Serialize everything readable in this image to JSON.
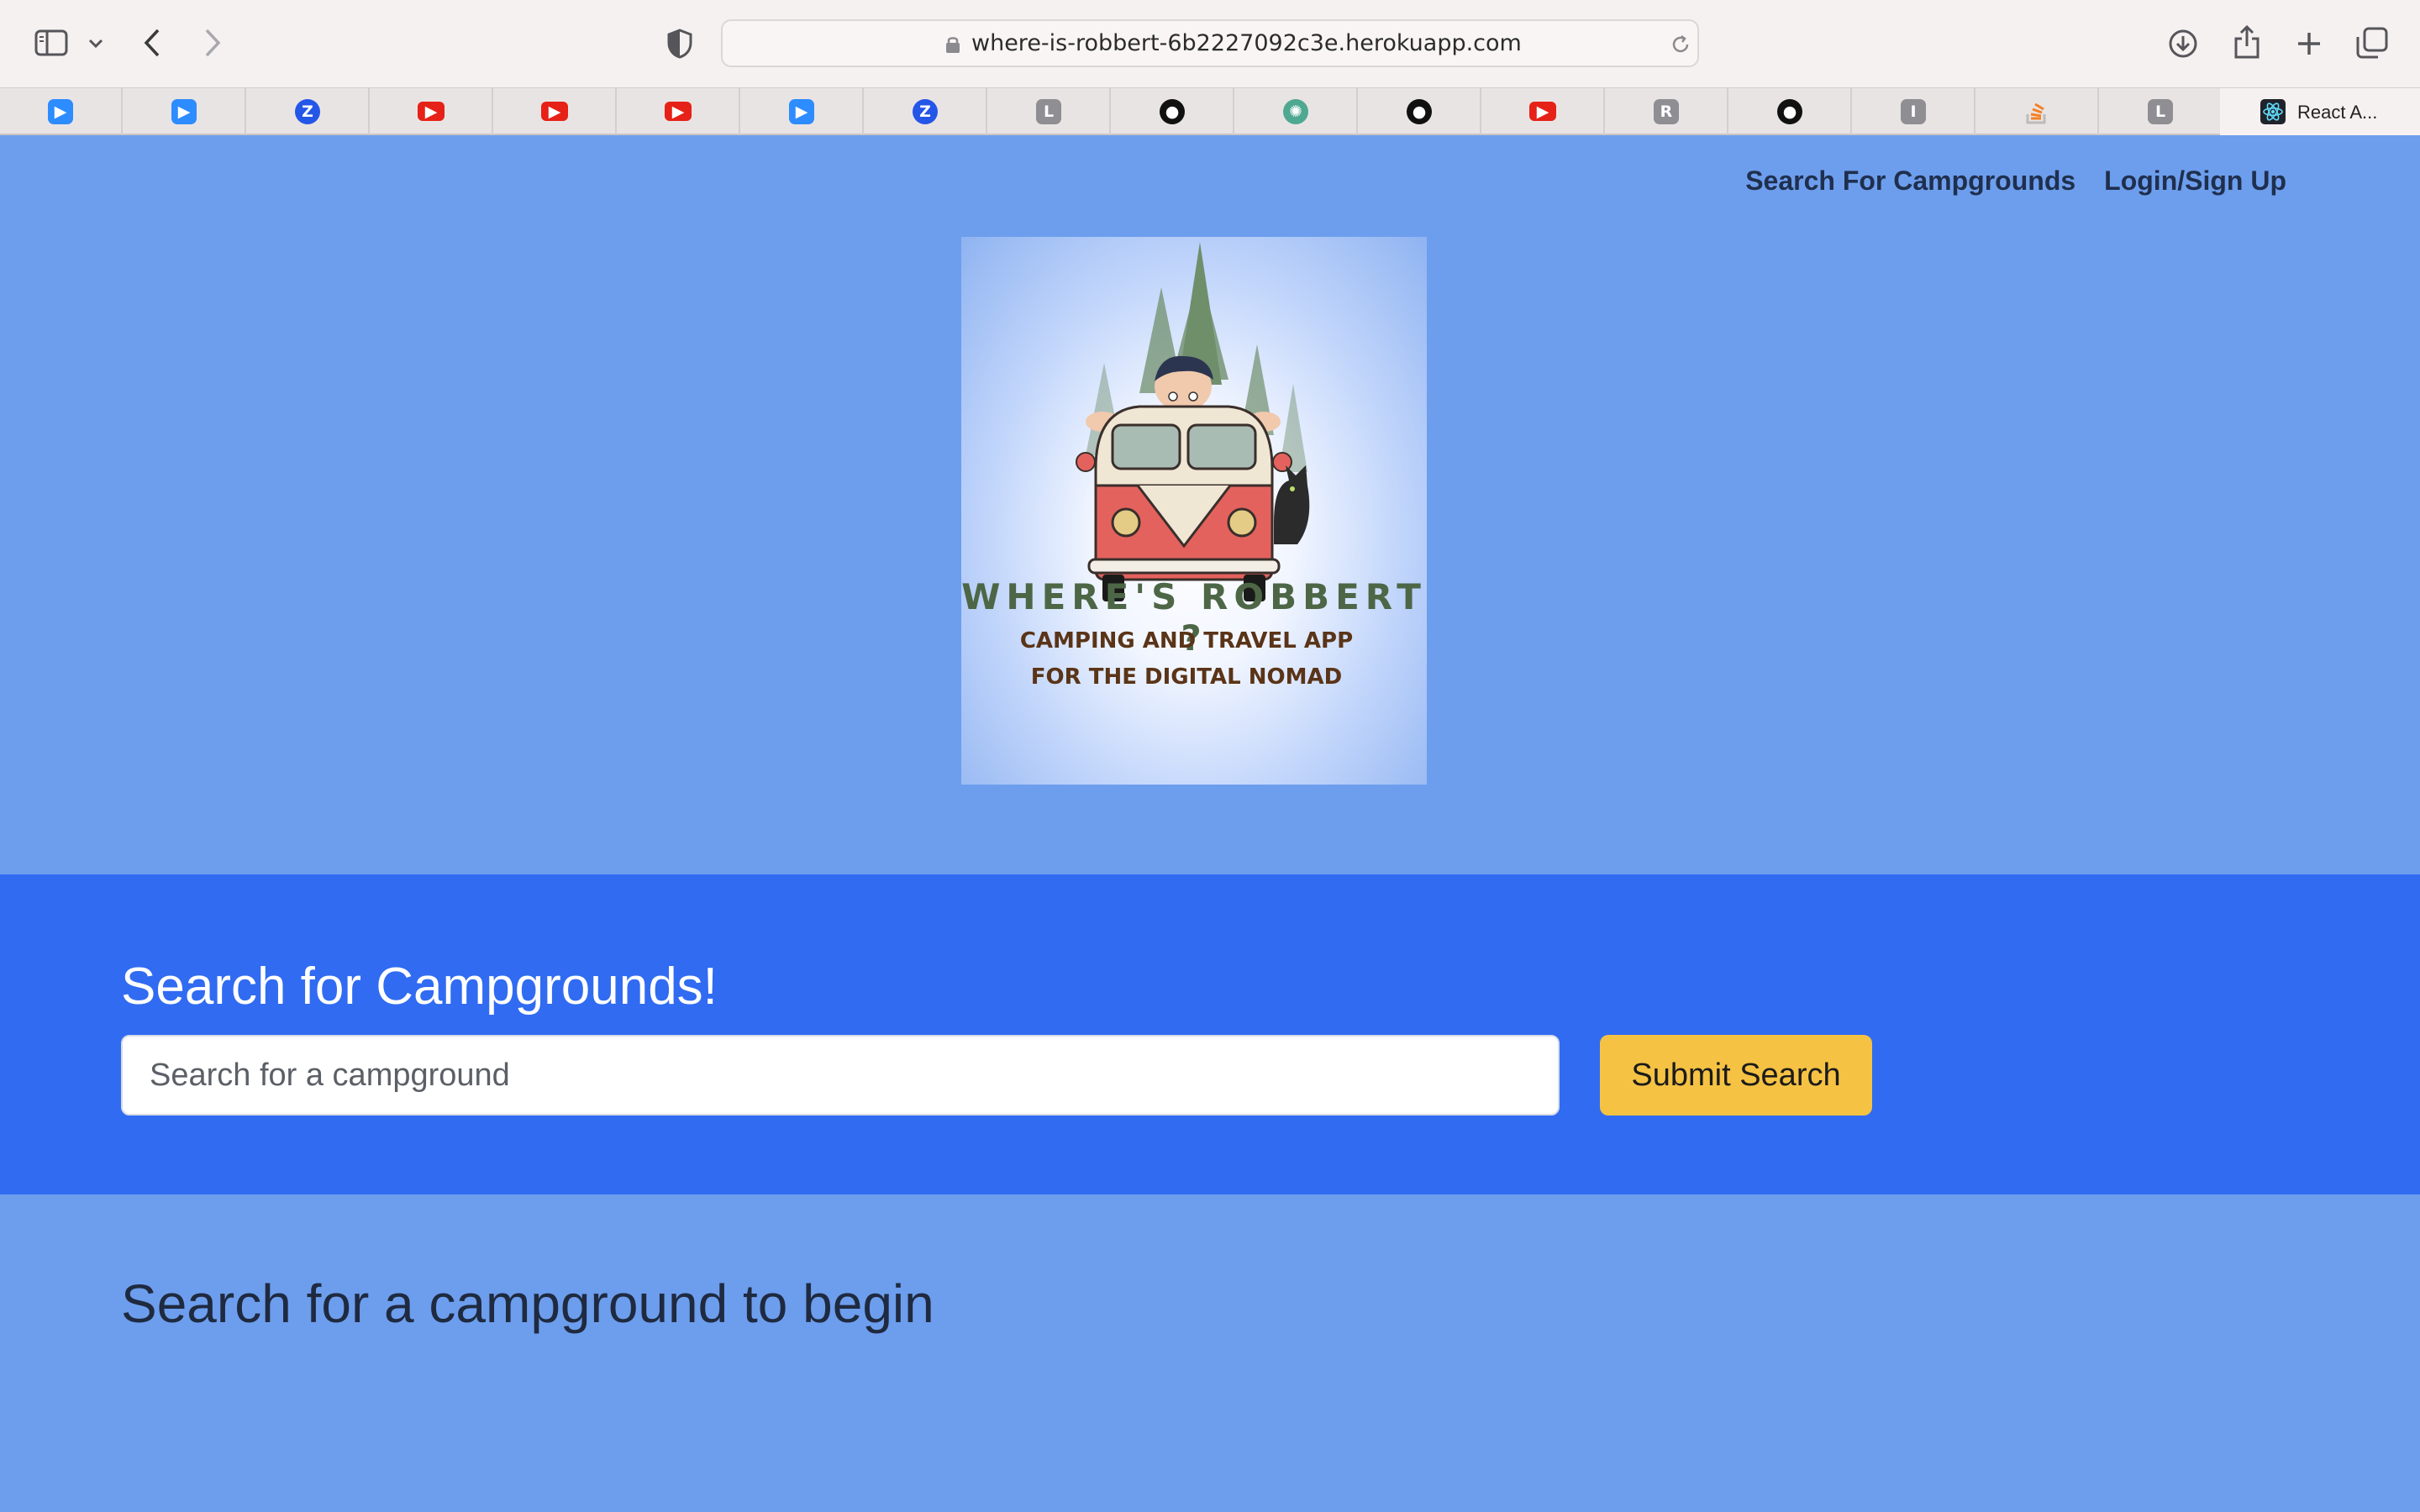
{
  "browser": {
    "url": "where-is-robbert-6b2227092c3e.herokuapp.com",
    "active_tab_title": "React A...",
    "tab_favicons": [
      "zoom-icon",
      "zoom-icon",
      "zotero-icon",
      "youtube-icon",
      "youtube-icon",
      "youtube-icon",
      "zoom-icon",
      "zotero-icon",
      "letter-l-icon",
      "github-icon",
      "chatgpt-icon",
      "github-icon",
      "youtube-icon",
      "letter-r-icon",
      "github-icon",
      "letter-i-icon",
      "stackoverflow-icon",
      "letter-l-icon"
    ],
    "tab_letters": {
      "letter-l-icon": "L",
      "letter-r-icon": "R",
      "letter-i-icon": "I",
      "zotero-icon": "Z"
    }
  },
  "nav": {
    "search_link": "Search For Campgrounds",
    "login_link": "Login/Sign Up"
  },
  "hero": {
    "logo_title": "WHERE'S ROBBERT ?",
    "logo_line1": "CAMPING AND TRAVEL APP",
    "logo_line2": "FOR THE DIGITAL NOMAD"
  },
  "search": {
    "title": "Search for Campgrounds!",
    "placeholder": "Search for a campground",
    "value": "",
    "submit_label": "Submit Search"
  },
  "results": {
    "empty_message": "Search for a campground to begin"
  },
  "colors": {
    "page_bg": "#6d9eed",
    "search_band": "#306bf2",
    "submit_button": "#f5c243",
    "nav_text": "#1f2f4e"
  }
}
